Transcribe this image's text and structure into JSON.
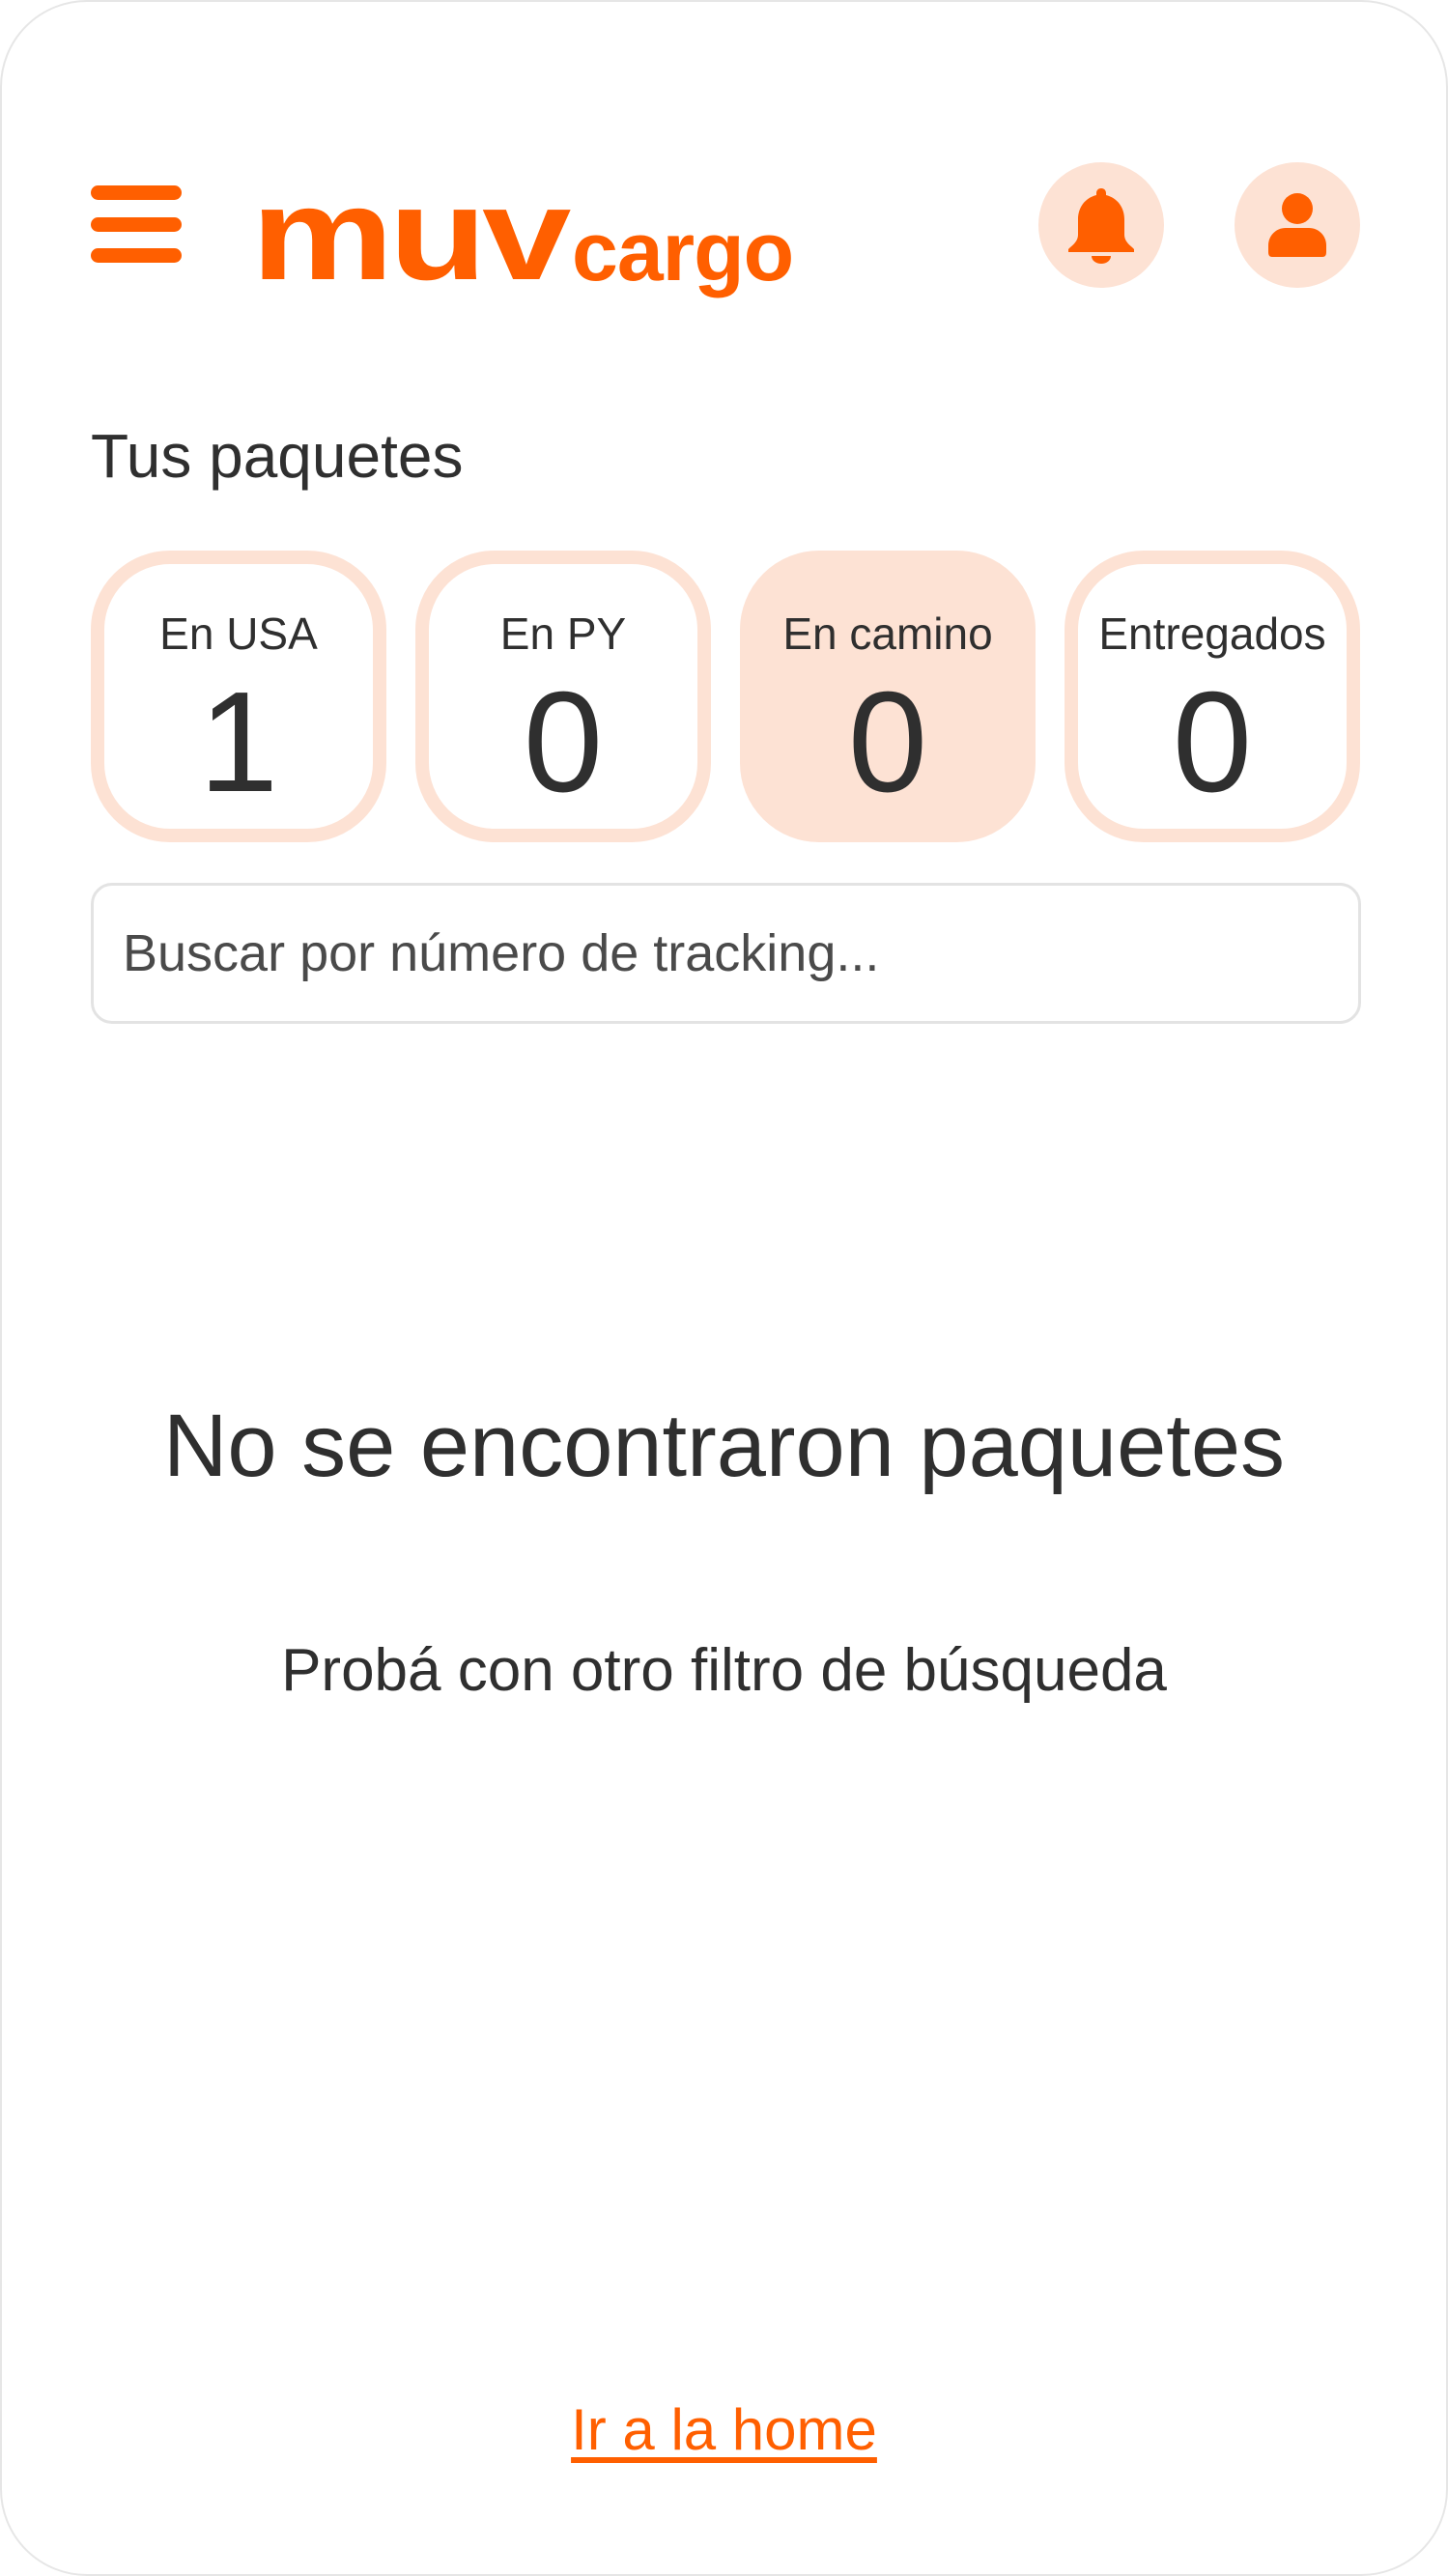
{
  "colors": {
    "brand": "#ff5f00",
    "brand_light": "#fde2d4",
    "text": "#2f2f2f"
  },
  "header": {
    "menu_icon": "hamburger-menu-icon",
    "logo_primary": "muv",
    "logo_secondary": "cargo",
    "notifications_icon": "bell-icon",
    "profile_icon": "user-icon"
  },
  "main": {
    "title": "Tus paquetes",
    "tabs": [
      {
        "label": "En USA",
        "count": "1",
        "active": false
      },
      {
        "label": "En PY",
        "count": "0",
        "active": false
      },
      {
        "label": "En camino",
        "count": "0",
        "active": true
      },
      {
        "label": "Entregados",
        "count": "0",
        "active": false
      }
    ],
    "search": {
      "placeholder": "Buscar por número de tracking...",
      "value": ""
    },
    "empty_state": {
      "title": "No se encontraron paquetes",
      "subtitle": "Probá con otro filtro de búsqueda"
    },
    "home_link": "Ir a la home"
  }
}
